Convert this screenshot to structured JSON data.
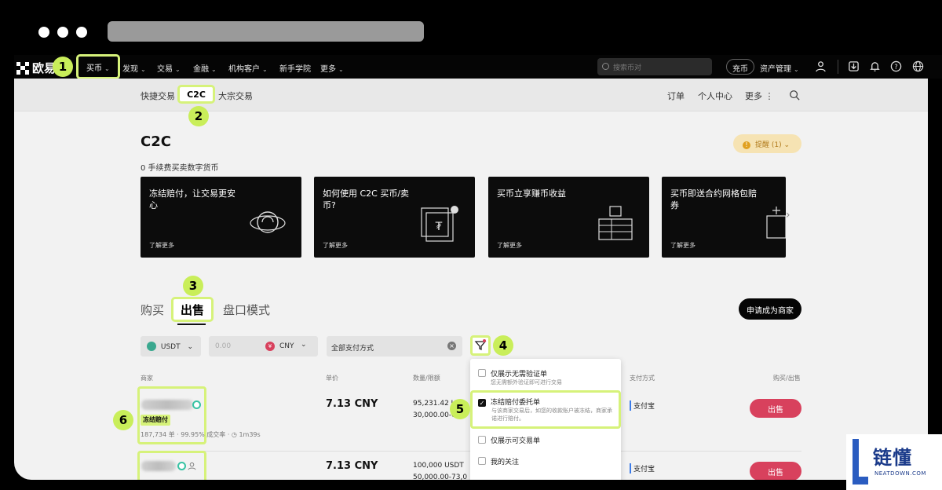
{
  "top_nav": {
    "logo": "欧易",
    "items": [
      "买币",
      "发现",
      "交易",
      "金融",
      "机构客户",
      "新手学院",
      "更多"
    ],
    "search_placeholder": "搜索币对",
    "deposit": "充币",
    "assets": "资产管理"
  },
  "sub_nav": {
    "left": [
      "快捷交易",
      "C2C",
      "大宗交易"
    ],
    "right": [
      "订单",
      "个人中心",
      "更多"
    ]
  },
  "header": {
    "title": "C2C",
    "subtitle": "0 手续费买卖数字货币",
    "notice": "提醒 (1)"
  },
  "cards": [
    {
      "title": "冻结赔付，让交易更安心",
      "more": "了解更多"
    },
    {
      "title": "如何使用 C2C 买币/卖币?",
      "more": "了解更多"
    },
    {
      "title": "买币立享赚币收益",
      "more": "了解更多"
    },
    {
      "title": "买币即送合约网格包赔券",
      "more": "了解更多"
    }
  ],
  "trade_tabs": [
    "购买",
    "出售",
    "盘口模式"
  ],
  "merchant_button": "申请成为商家",
  "filters": {
    "coin": "USDT",
    "amount_placeholder": "0.00",
    "fiat": "CNY",
    "payment": "全部支付方式"
  },
  "columns": [
    "商家",
    "单价",
    "数量/限额",
    "支付方式",
    "购买/出售"
  ],
  "rows": [
    {
      "badge": "冻结赔付",
      "stats": "187,734 单 · 99.95% 成交率 · ◷ 1m39s",
      "price": "7.13 CNY",
      "qty": "95,231.42 U",
      "limit": "30,000.00-6",
      "pay": "支付宝",
      "action": "出售"
    },
    {
      "price": "7.13 CNY",
      "qty": "100,000 USDT",
      "limit": "50,000.00-73,0",
      "pay": "支付宝",
      "action": "出售"
    }
  ],
  "filter_menu": [
    {
      "label": "仅展示无需验证单",
      "desc": "您无需额外验证即可进行交易",
      "checked": false
    },
    {
      "label": "冻结赔付委托单",
      "desc": "与该商家交易后，如您的收款账户被冻结，商家承诺进行赔付。",
      "checked": true
    },
    {
      "label": "仅展示可交易单",
      "desc": "",
      "checked": false
    },
    {
      "label": "我的关注",
      "desc": "",
      "checked": false
    }
  ],
  "step_badges": [
    "1",
    "2",
    "3",
    "4",
    "5",
    "6"
  ],
  "watermark": {
    "cn": "链懂",
    "en": "NEATDOWN.COM"
  },
  "colors": {
    "highlight": "#d6f27a",
    "sell": "#d8415d",
    "badge": "#c9ee5a"
  }
}
